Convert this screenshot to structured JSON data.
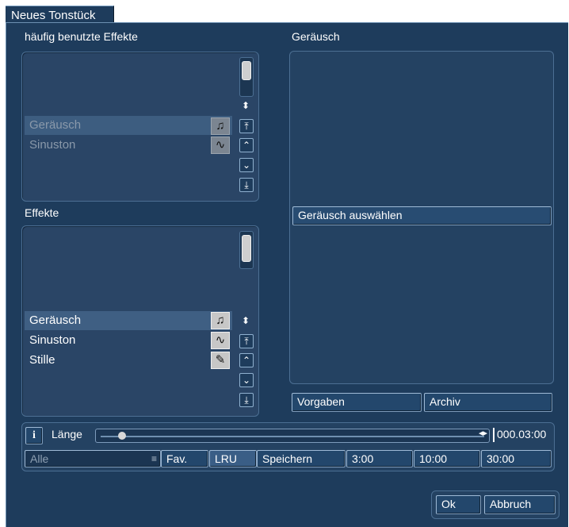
{
  "window": {
    "title": "Neues Tonstück"
  },
  "favorites": {
    "label": "häufig benutzte Effekte",
    "items": [
      {
        "label": "Geräusch",
        "icon": "music-note-icon"
      },
      {
        "label": "Sinuston",
        "icon": "sine-wave-icon"
      }
    ]
  },
  "effects": {
    "label": "Effekte",
    "items": [
      {
        "label": "Geräusch",
        "icon": "music-note-icon"
      },
      {
        "label": "Sinuston",
        "icon": "sine-wave-icon"
      },
      {
        "label": "Stille",
        "icon": "silence-icon"
      }
    ]
  },
  "preview": {
    "label": "Geräusch",
    "select_label": "Geräusch auswählen",
    "presets_label": "Vorgaben",
    "archive_label": "Archiv"
  },
  "length": {
    "info_label": "i",
    "label": "Länge",
    "value": "000.03:00",
    "slider_fraction": 0.0
  },
  "filter": {
    "all_label": "Alle",
    "fav_label": "Fav.",
    "lru_label": "LRU",
    "save_label": "Speichern",
    "presets": [
      "3:00",
      "10:00",
      "30:00"
    ]
  },
  "footer": {
    "ok_label": "Ok",
    "cancel_label": "Abbruch"
  },
  "colors": {
    "background": "#1e3c5c",
    "panel": "#2a4566",
    "selected_row": "#3d5d80"
  }
}
